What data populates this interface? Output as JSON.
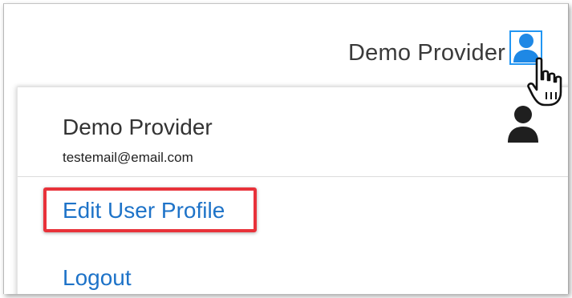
{
  "header": {
    "user_name": "Demo Provider"
  },
  "user_menu": {
    "name": "Demo Provider",
    "email": "testemail@email.com",
    "items": [
      {
        "label": "Edit User Profile"
      },
      {
        "label": "Logout"
      }
    ]
  },
  "colors": {
    "link": "#1e73c8",
    "accent": "#2196f3",
    "highlight": "#e8323a"
  },
  "icons": {
    "avatar_button": "user-icon",
    "menu_avatar": "user-icon",
    "cursor": "hand-pointer-icon"
  }
}
